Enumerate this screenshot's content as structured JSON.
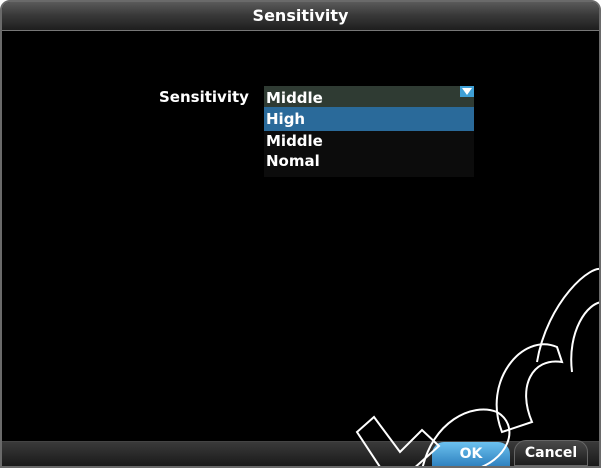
{
  "dialog": {
    "title": "Sensitivity"
  },
  "form": {
    "sensitivity_label": "Sensitivity",
    "dropdown": {
      "selected_value": "Middle",
      "options": [
        {
          "label": "High",
          "highlighted": true
        },
        {
          "label": "Middle",
          "highlighted": false
        },
        {
          "label": "Nomal",
          "highlighted": false
        }
      ]
    }
  },
  "footer": {
    "ok_label": "OK",
    "cancel_label": "Cancel"
  },
  "colors": {
    "background": "#000000",
    "highlight": "#2a6a9a",
    "accent": "#3fa0d6"
  },
  "icons": {
    "dropdown": "chevron-down-icon"
  }
}
